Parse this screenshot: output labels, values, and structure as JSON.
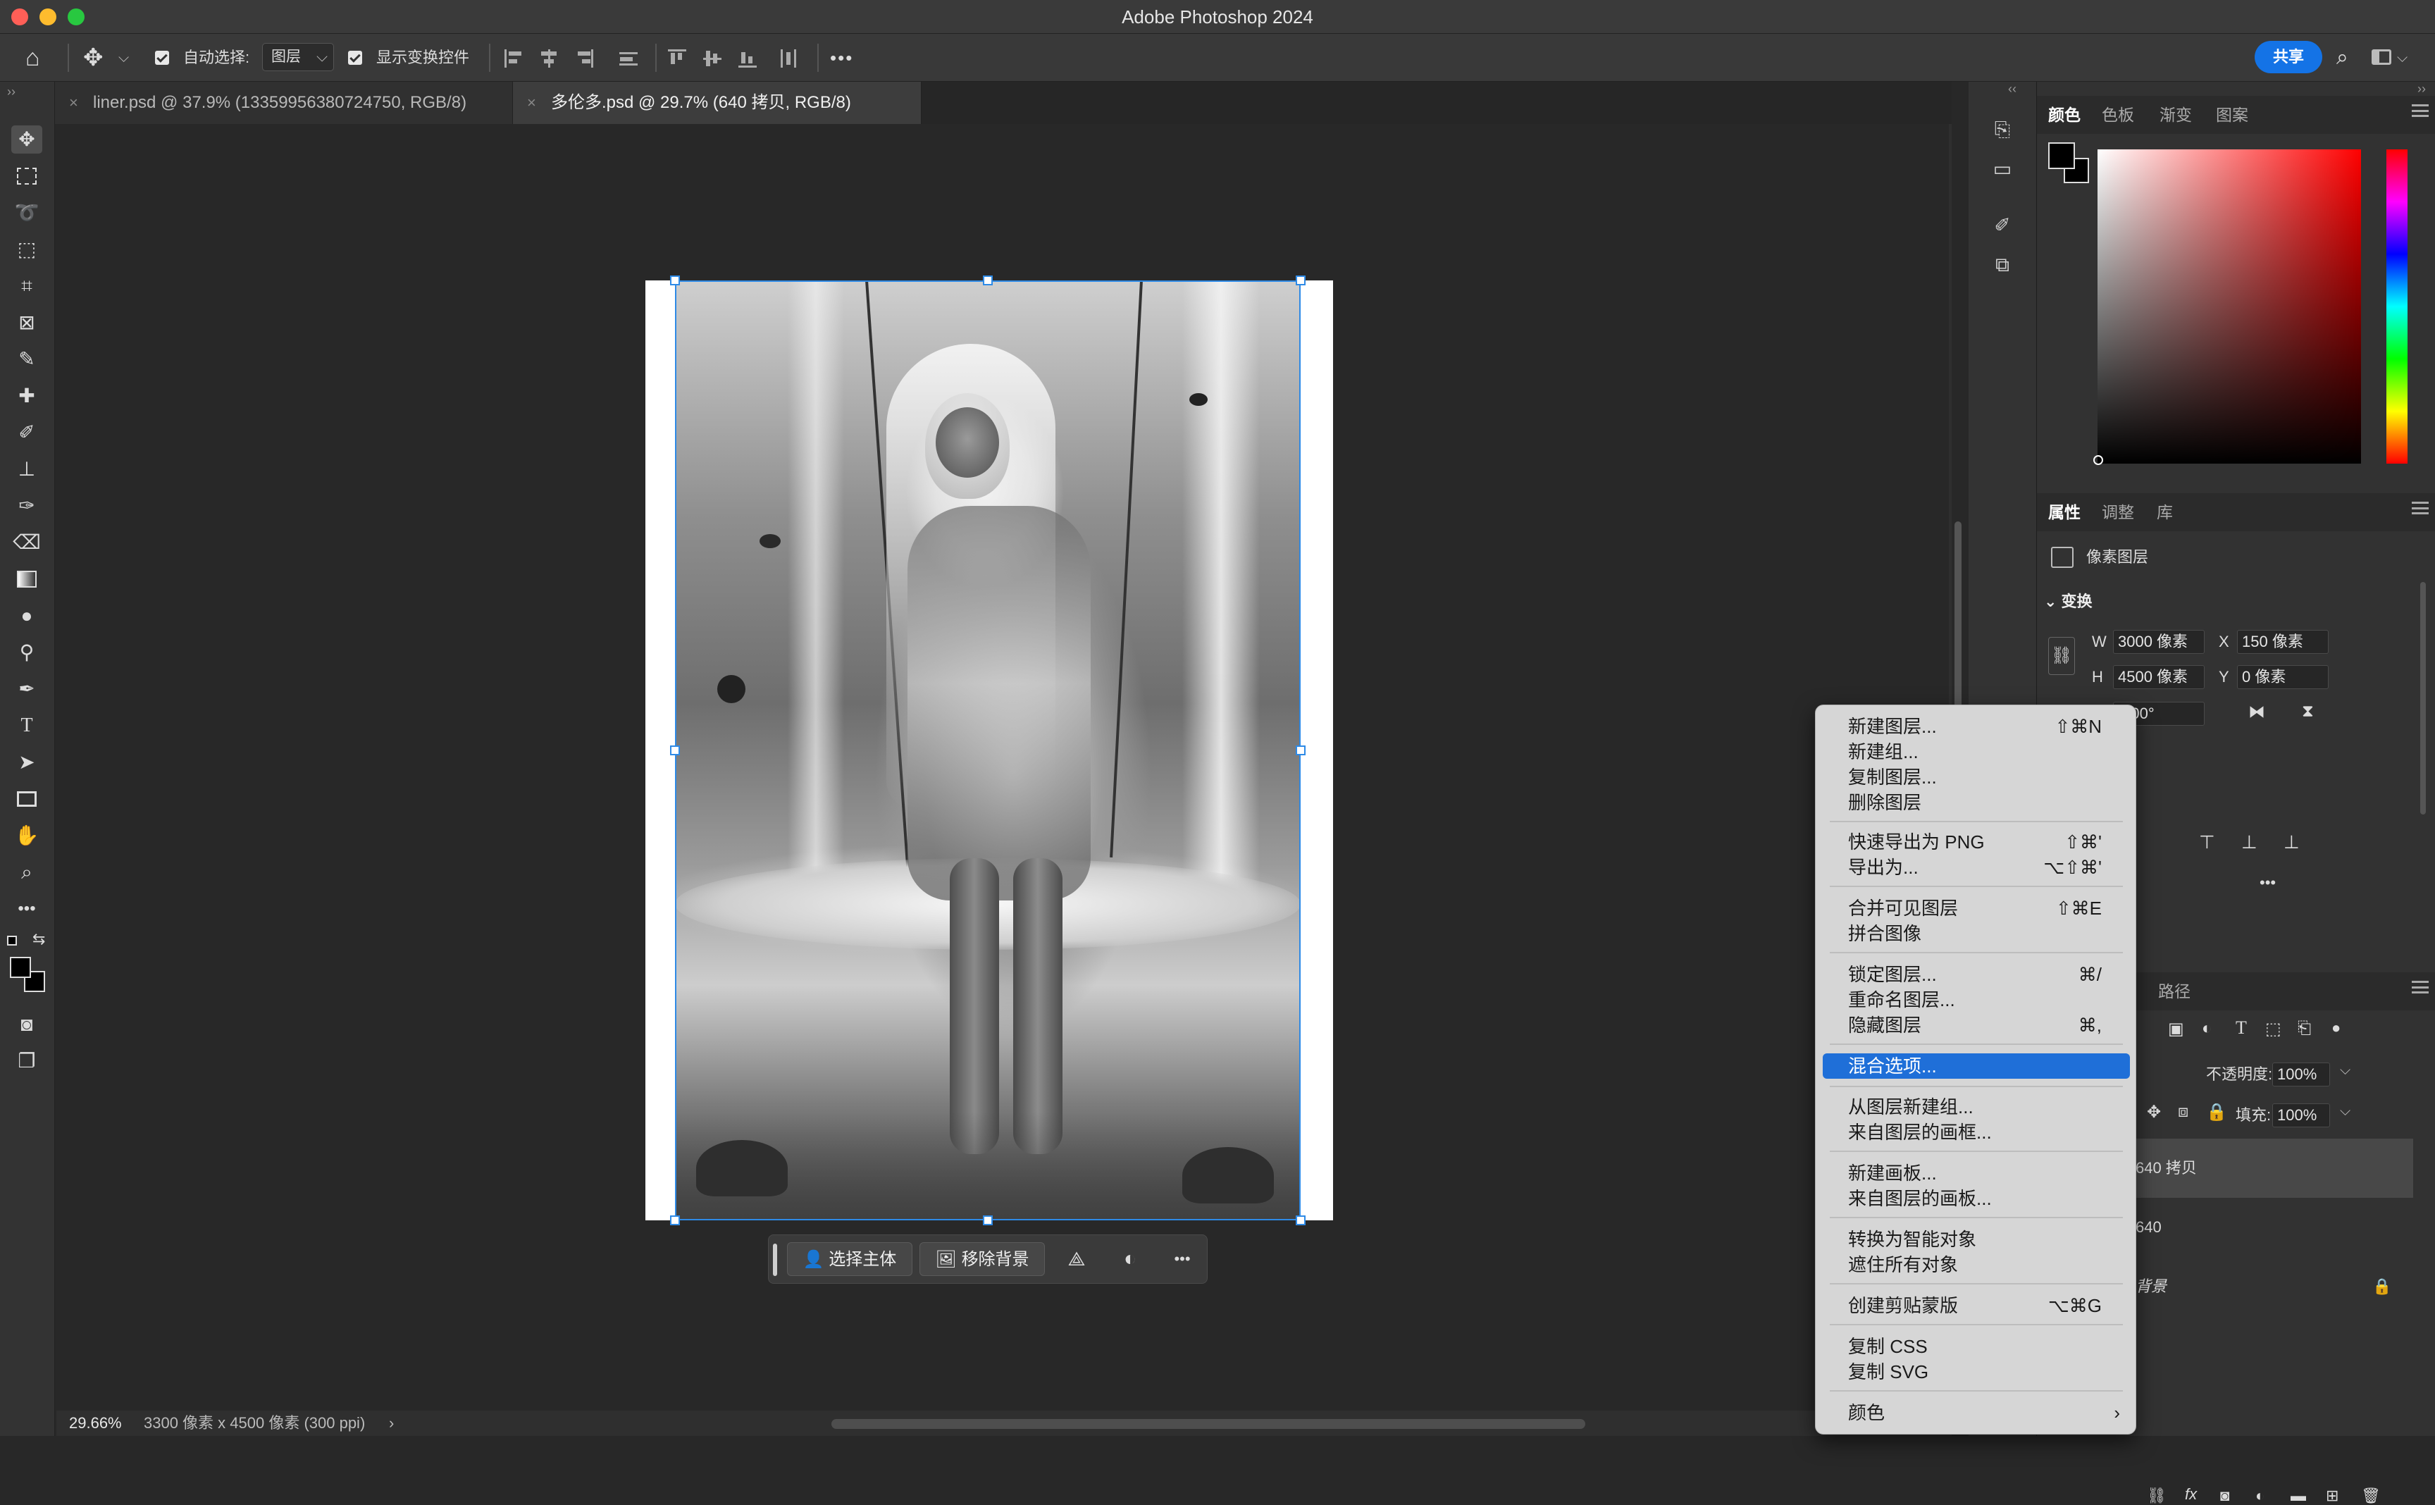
{
  "app": {
    "title": "Adobe Photoshop 2024"
  },
  "options_bar": {
    "auto_select_label": "自动选择:",
    "auto_select_value": "图层",
    "show_transform_label": "显示变换控件",
    "more_label": "•••",
    "share_label": "共享"
  },
  "tabs": [
    {
      "label": "liner.psd @ 37.9% (13359956380724750, RGB/8)",
      "close": "×"
    },
    {
      "label": "多伦多.psd @ 29.7% (640 拷贝, RGB/8)",
      "close": "×"
    }
  ],
  "task_bar": {
    "select_subject": "选择主体",
    "remove_background": "移除背景",
    "more": "•••"
  },
  "status": {
    "zoom": "29.66%",
    "info": "3300 像素 x 4500 像素 (300 ppi)",
    "arrow": "›"
  },
  "color_panel": {
    "tabs": [
      "颜色",
      "色板",
      "渐变",
      "图案"
    ]
  },
  "properties_panel": {
    "tabs": [
      "属性",
      "调整",
      "库"
    ],
    "layer_type": "像素图层",
    "transform_label": "变换",
    "w_label": "W",
    "w_value": "3000 像素",
    "h_label": "H",
    "h_value": "4500 像素",
    "x_label": "X",
    "x_value": "150 像素",
    "y_label": "Y",
    "y_value": "0 像素",
    "angle_value": "0.00°",
    "more": "•••"
  },
  "layers_panel": {
    "paths_tab": "路径",
    "opacity_label": "不透明度:",
    "opacity_value": "100%",
    "fill_label": "填充:",
    "fill_value": "100%",
    "layers": [
      "640 拷贝",
      "640",
      "背景"
    ]
  },
  "context_menu": {
    "items": [
      {
        "label": "新建图层...",
        "shortcut": "⇧⌘N"
      },
      {
        "label": "新建组...",
        "shortcut": ""
      },
      {
        "label": "复制图层...",
        "shortcut": ""
      },
      {
        "label": "删除图层",
        "shortcut": ""
      },
      {
        "label": "快速导出为 PNG",
        "shortcut": "⇧⌘'"
      },
      {
        "label": "导出为...",
        "shortcut": "⌥⇧⌘'"
      },
      {
        "label": "合并可见图层",
        "shortcut": "⇧⌘E"
      },
      {
        "label": "拼合图像",
        "shortcut": ""
      },
      {
        "label": "锁定图层...",
        "shortcut": "⌘/"
      },
      {
        "label": "重命名图层...",
        "shortcut": ""
      },
      {
        "label": "隐藏图层",
        "shortcut": "⌘,"
      },
      {
        "label": "混合选项...",
        "shortcut": ""
      },
      {
        "label": "从图层新建组...",
        "shortcut": ""
      },
      {
        "label": "来自图层的画框...",
        "shortcut": ""
      },
      {
        "label": "新建画板...",
        "shortcut": ""
      },
      {
        "label": "来自图层的画板...",
        "shortcut": ""
      },
      {
        "label": "转换为智能对象",
        "shortcut": ""
      },
      {
        "label": "遮住所有对象",
        "shortcut": ""
      },
      {
        "label": "创建剪贴蒙版",
        "shortcut": "⌥⌘G"
      },
      {
        "label": "复制 CSS",
        "shortcut": ""
      },
      {
        "label": "复制 SVG",
        "shortcut": ""
      },
      {
        "label": "颜色",
        "shortcut": "›"
      }
    ],
    "highlighted": "混合选项..."
  }
}
